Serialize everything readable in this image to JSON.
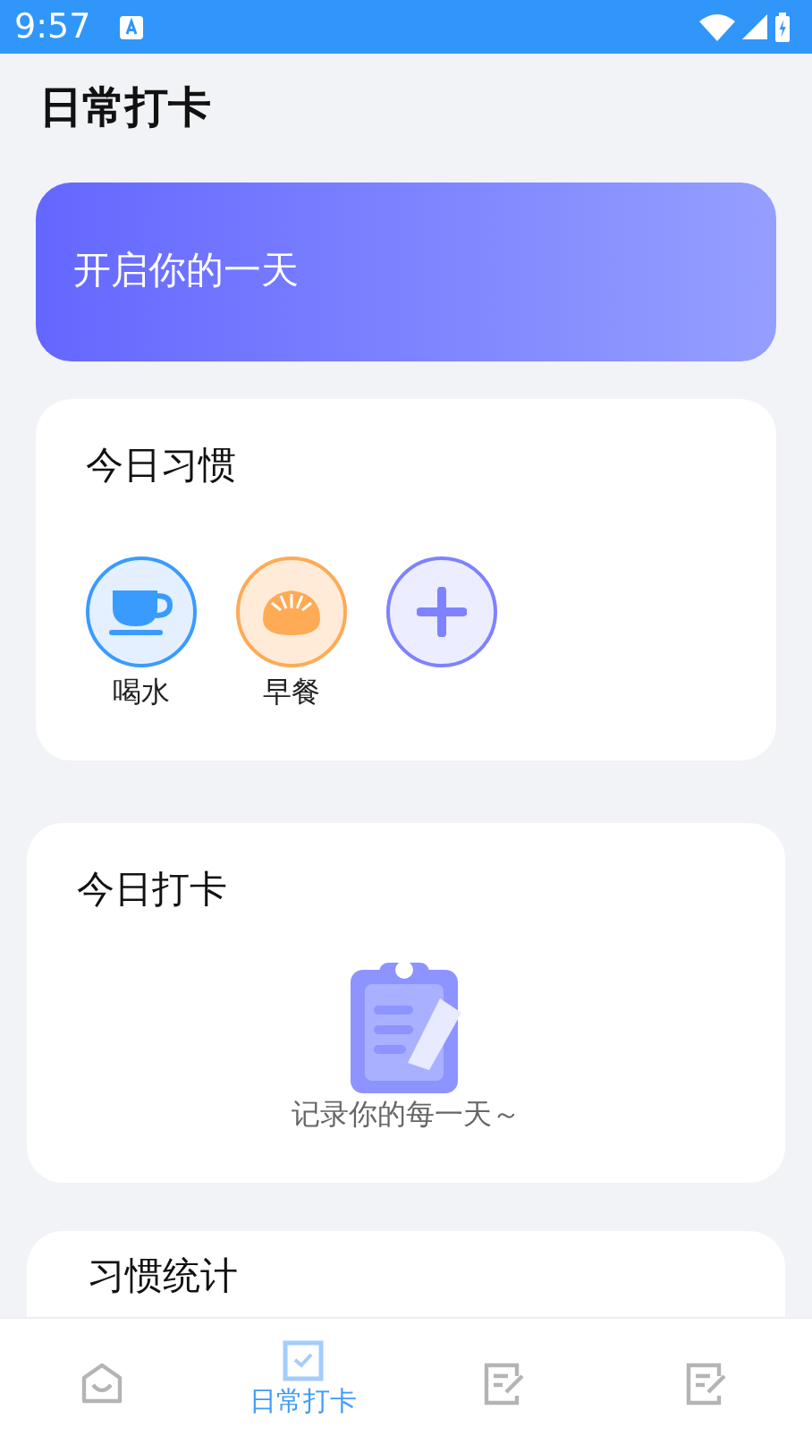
{
  "status_bar": {
    "time": "9:57"
  },
  "header": {
    "title": "日常打卡"
  },
  "banner": {
    "text": "开启你的一天"
  },
  "habits_card": {
    "title": "今日习惯",
    "habits": [
      {
        "kind": "cup",
        "label": "喝水",
        "color": "#3a9bff"
      },
      {
        "kind": "bun",
        "label": "早餐",
        "color": "#ffaa55"
      },
      {
        "kind": "add",
        "color": "#7e82ff"
      }
    ]
  },
  "checkin_card": {
    "title": "今日打卡",
    "empty_text": "记录你的每一天～"
  },
  "stats_card": {
    "title": "习惯统计"
  },
  "bottom_nav": [
    {
      "kind": "home",
      "selected": false
    },
    {
      "kind": "check",
      "label": "日常打卡",
      "selected": true
    },
    {
      "kind": "note",
      "selected": false
    },
    {
      "kind": "note",
      "selected": false
    }
  ]
}
